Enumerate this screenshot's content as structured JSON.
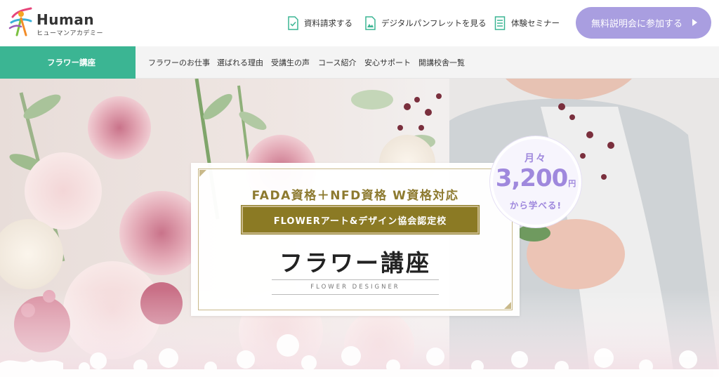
{
  "header": {
    "logo_name": "Human",
    "logo_sub": "ヒューマンアカデミー",
    "links": [
      {
        "label": "資料請求する",
        "icon": "document-icon"
      },
      {
        "label": "デジタルパンフレットを見る",
        "icon": "pamphlet-icon"
      },
      {
        "label": "体験セミナー",
        "icon": "list-icon"
      }
    ],
    "cta_label": "無料説明会に参加する"
  },
  "nav": {
    "active": "フラワー講座",
    "items": [
      "フラワーのお仕事",
      "選ばれる理由",
      "受講生の声",
      "コース紹介",
      "安心サポート",
      "開講校舎一覧"
    ]
  },
  "hero": {
    "subtitle": "FADA資格＋NFD資格 W資格対応",
    "band": "FLOWERアート&デザイン協会認定校",
    "title": "フラワー講座",
    "english": "FLOWER DESIGNER",
    "badge": {
      "top": "月々",
      "price": "3,200",
      "unit": "円",
      "bottom": "から学べる!"
    }
  },
  "colors": {
    "accent_green": "#3bb593",
    "cta_purple": "#a99ee0",
    "gold": "#8b7a24",
    "badge_purple": "#9f88dd"
  }
}
